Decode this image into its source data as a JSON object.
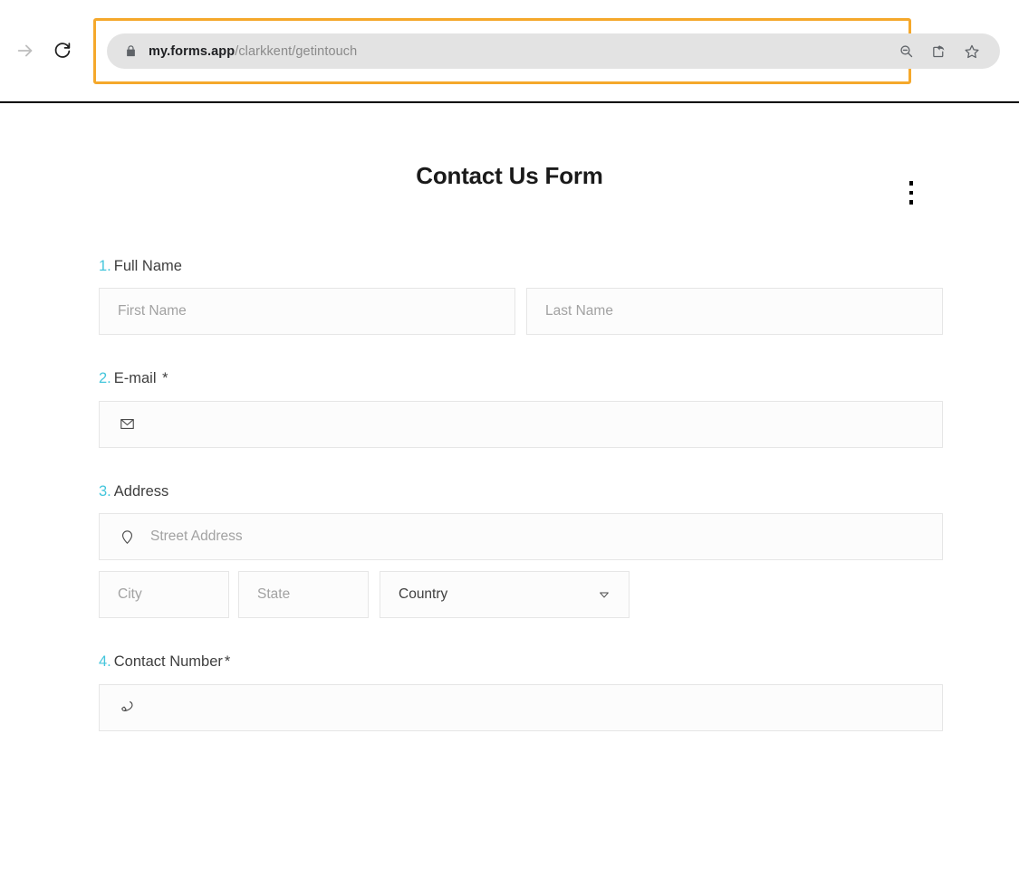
{
  "browser": {
    "nav": {
      "forward_icon": "arrow-right-icon",
      "reload_icon": "reload-icon"
    },
    "address_bar": {
      "lock_icon": "lock-icon",
      "url_domain": "my.forms.app",
      "url_path": "/clarkkent/getintouch",
      "full_url": "my.forms.app/clarkkent/getintouch",
      "actions": [
        {
          "name": "zoom-out-icon",
          "label": "Zoom out"
        },
        {
          "name": "share-icon",
          "label": "Share this page"
        },
        {
          "name": "star-icon",
          "label": "Bookmark this tab"
        }
      ],
      "highlight_color": "#f5a82b"
    }
  },
  "form": {
    "title": "Contact Us Form",
    "menu_label": "More options",
    "accent_color": "#45c6dc",
    "questions": [
      {
        "number": "1.",
        "label": "Full Name",
        "required": "",
        "type": "name",
        "fields": [
          {
            "name": "first-name-input",
            "placeholder": "First Name",
            "value": ""
          },
          {
            "name": "last-name-input",
            "placeholder": "Last Name",
            "value": ""
          }
        ]
      },
      {
        "number": "2.",
        "label": "E-mail",
        "required": "*",
        "type": "email",
        "fields": [
          {
            "name": "email-input",
            "icon": "envelope-icon",
            "placeholder": "",
            "value": ""
          }
        ]
      },
      {
        "number": "3.",
        "label": "Address",
        "required": "",
        "type": "address",
        "fields": [
          {
            "name": "street-address-input",
            "icon": "map-pin-icon",
            "placeholder": "Street Address",
            "value": ""
          },
          {
            "name": "city-input",
            "placeholder": "City",
            "value": ""
          },
          {
            "name": "state-input",
            "placeholder": "State",
            "value": ""
          },
          {
            "name": "country-select",
            "placeholder": "",
            "value": "Country",
            "icon": "chevron-down-icon"
          }
        ]
      },
      {
        "number": "4.",
        "label": "Contact Number",
        "required": "*",
        "type": "phone",
        "fields": [
          {
            "name": "phone-input",
            "icon": "phone-icon",
            "placeholder": "",
            "value": ""
          }
        ]
      }
    ]
  }
}
